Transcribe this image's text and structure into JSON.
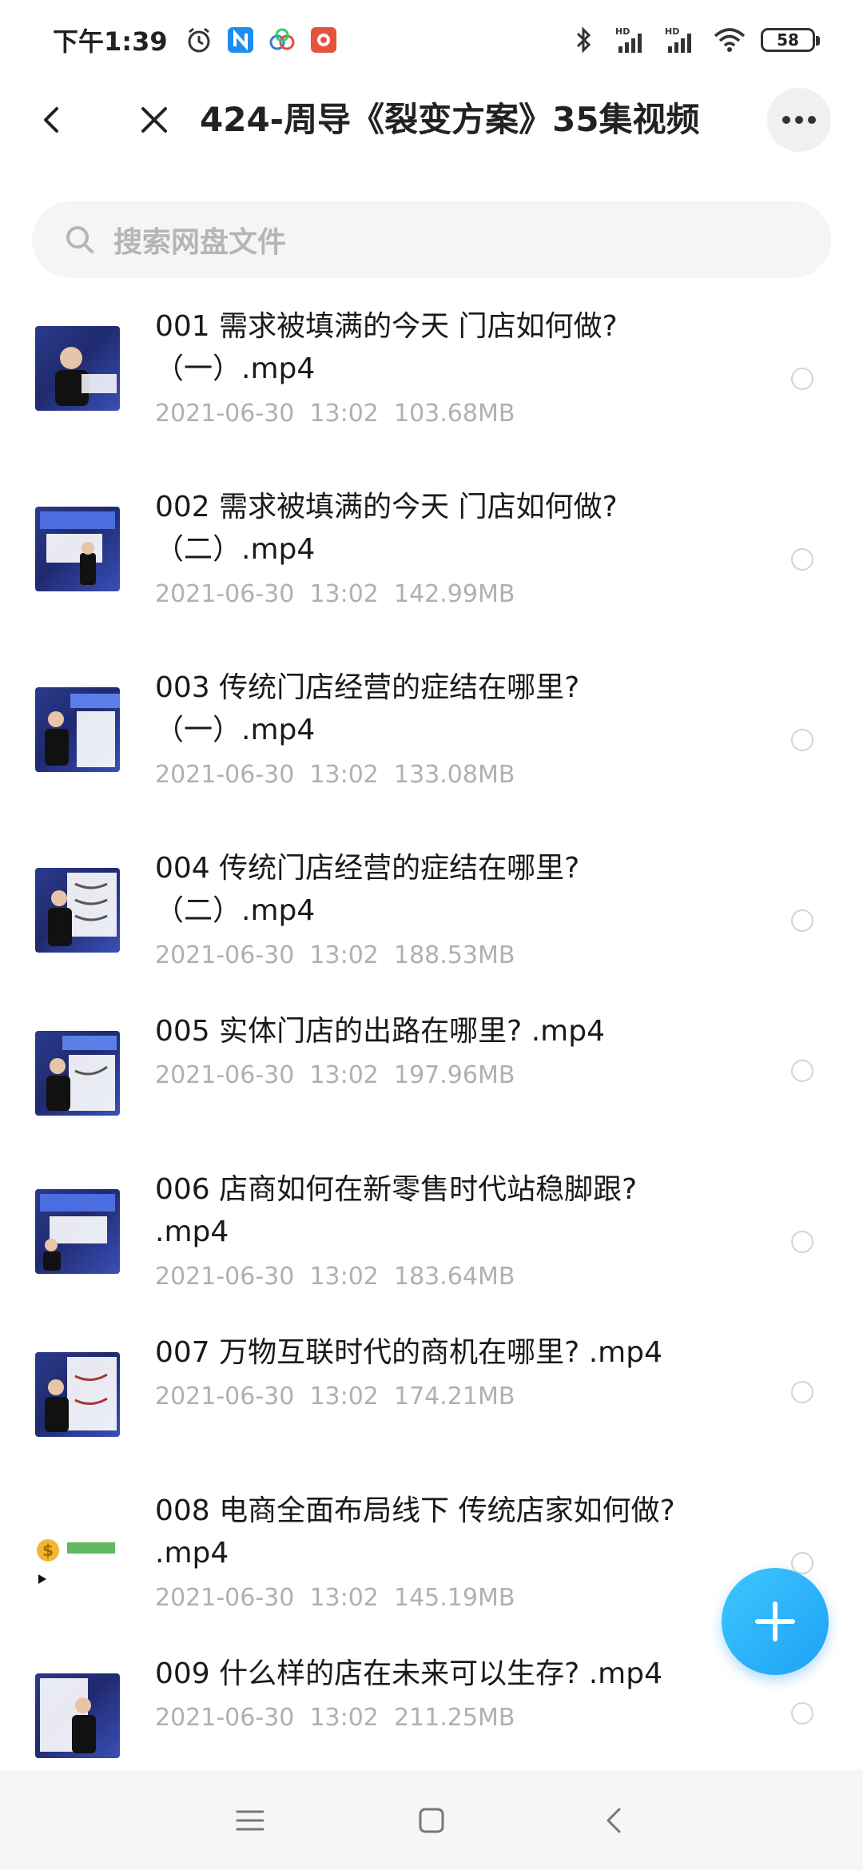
{
  "status_bar": {
    "time": "下午1:39",
    "battery": "58",
    "notification_icons": [
      "alarm-icon",
      "app-n-icon",
      "cloud-app-icon",
      "red-app-icon"
    ],
    "system_icons": [
      "bluetooth-icon",
      "signal-hd-1-icon",
      "signal-hd-2-icon",
      "wifi-icon"
    ],
    "hd_label": "HD"
  },
  "header": {
    "title": "424-周导《裂变方案》35集视频"
  },
  "search": {
    "placeholder": "搜索网盘文件"
  },
  "files": [
    {
      "name": "001 需求被填满的今天 门店如何做?（一）.mp4",
      "date": "2021-06-30",
      "time": "13:02",
      "size": "103.68MB",
      "thumb": "video"
    },
    {
      "name": "002 需求被填满的今天 门店如何做?（二）.mp4",
      "date": "2021-06-30",
      "time": "13:02",
      "size": "142.99MB",
      "thumb": "video"
    },
    {
      "name": "003 传统门店经营的症结在哪里?（一）.mp4",
      "date": "2021-06-30",
      "time": "13:02",
      "size": "133.08MB",
      "thumb": "video"
    },
    {
      "name": "004 传统门店经营的症结在哪里?（二）.mp4",
      "date": "2021-06-30",
      "time": "13:02",
      "size": "188.53MB",
      "thumb": "video"
    },
    {
      "name": "005 实体门店的出路在哪里? .mp4",
      "date": "2021-06-30",
      "time": "13:02",
      "size": "197.96MB",
      "thumb": "video"
    },
    {
      "name": "006 店商如何在新零售时代站稳脚跟? .mp4",
      "date": "2021-06-30",
      "time": "13:02",
      "size": "183.64MB",
      "thumb": "video"
    },
    {
      "name": "007 万物互联时代的商机在哪里? .mp4",
      "date": "2021-06-30",
      "time": "13:02",
      "size": "174.21MB",
      "thumb": "video"
    },
    {
      "name": "008 电商全面布局线下 传统店家如何做? .mp4",
      "date": "2021-06-30",
      "time": "13:02",
      "size": "145.19MB",
      "thumb": "plain"
    },
    {
      "name": "009 什么样的店在未来可以生存? .mp4",
      "date": "2021-06-30",
      "time": "13:02",
      "size": "211.25MB",
      "thumb": "video"
    }
  ],
  "colors": {
    "accent": "#1ea2f5",
    "meta_text": "#b0b0b0",
    "search_bg": "#f5f5f5"
  }
}
